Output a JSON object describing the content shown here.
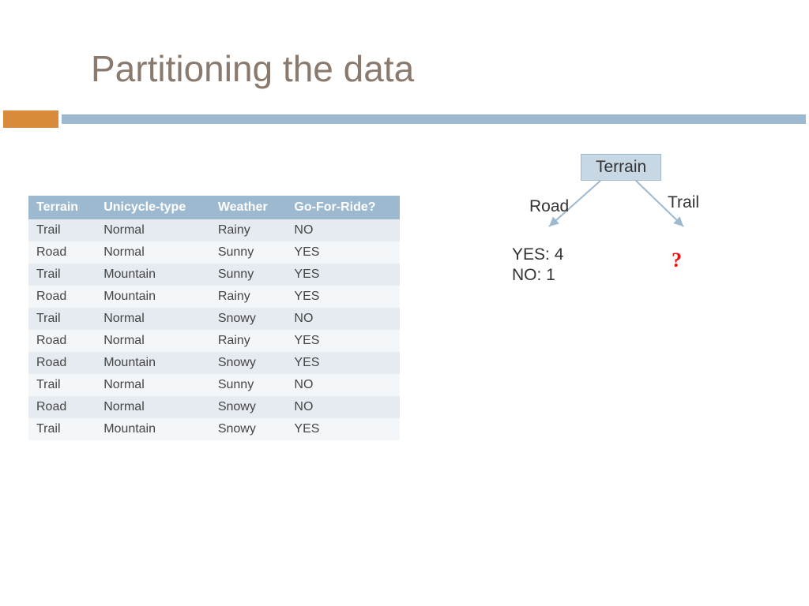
{
  "slide_title": "Partitioning the data",
  "columns": [
    "Terrain",
    "Unicycle-type",
    "Weather",
    "Go-For-Ride?"
  ],
  "rows": [
    [
      "Trail",
      "Normal",
      "Rainy",
      "NO"
    ],
    [
      "Road",
      "Normal",
      "Sunny",
      "YES"
    ],
    [
      "Trail",
      "Mountain",
      "Sunny",
      "YES"
    ],
    [
      "Road",
      "Mountain",
      "Rainy",
      "YES"
    ],
    [
      "Trail",
      "Normal",
      "Snowy",
      "NO"
    ],
    [
      "Road",
      "Normal",
      "Rainy",
      "YES"
    ],
    [
      "Road",
      "Mountain",
      "Snowy",
      "YES"
    ],
    [
      "Trail",
      "Normal",
      "Sunny",
      "NO"
    ],
    [
      "Road",
      "Normal",
      "Snowy",
      "NO"
    ],
    [
      "Trail",
      "Mountain",
      "Snowy",
      "YES"
    ]
  ],
  "tree": {
    "root": "Terrain",
    "left_edge": "Road",
    "right_edge": "Trail",
    "left_line1": "YES: 4",
    "left_line2": "NO: 1",
    "right_leaf": "?"
  },
  "chart_data": {
    "type": "table",
    "columns": [
      "Terrain",
      "Unicycle-type",
      "Weather",
      "Go-For-Ride?"
    ],
    "rows": [
      [
        "Trail",
        "Normal",
        "Rainy",
        "NO"
      ],
      [
        "Road",
        "Normal",
        "Sunny",
        "YES"
      ],
      [
        "Trail",
        "Mountain",
        "Sunny",
        "YES"
      ],
      [
        "Road",
        "Mountain",
        "Rainy",
        "YES"
      ],
      [
        "Trail",
        "Normal",
        "Snowy",
        "NO"
      ],
      [
        "Road",
        "Normal",
        "Rainy",
        "YES"
      ],
      [
        "Road",
        "Mountain",
        "Snowy",
        "YES"
      ],
      [
        "Trail",
        "Normal",
        "Sunny",
        "NO"
      ],
      [
        "Road",
        "Normal",
        "Snowy",
        "NO"
      ],
      [
        "Trail",
        "Mountain",
        "Snowy",
        "YES"
      ]
    ],
    "decision_tree": {
      "attribute": "Terrain",
      "branches": {
        "Road": {
          "YES": 4,
          "NO": 1
        },
        "Trail": "?"
      }
    }
  }
}
